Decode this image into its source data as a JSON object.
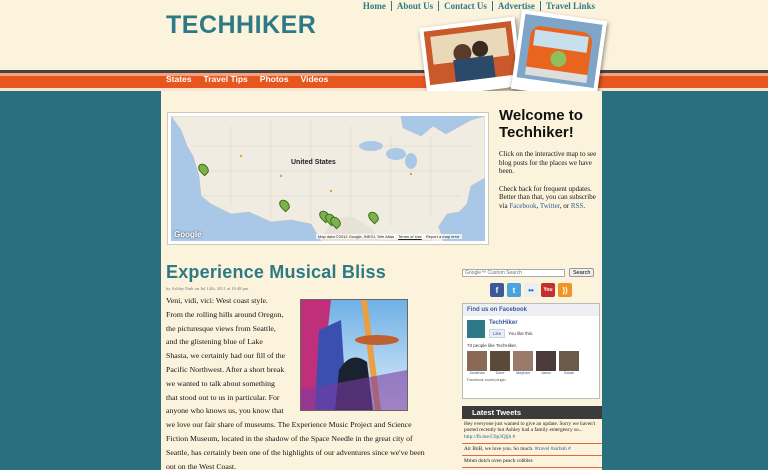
{
  "brand": {
    "logo": "TECHHIKER"
  },
  "top_nav": [
    "Home",
    "About Us",
    "Contact Us",
    "Advertise",
    "Travel Links"
  ],
  "main_nav": [
    "States",
    "Travel Tips",
    "Photos",
    "Videos"
  ],
  "map": {
    "country_label": "United States",
    "attribution": "Map data ©2012 Google, INEGI, Tele Atlas",
    "terms": "Terms of Use",
    "report": "Report a map error",
    "google": "Google",
    "marker_label": "7"
  },
  "welcome": {
    "title": "Welcome to Techhiker!",
    "para1": "Click on the interactive map to see blog posts for the places we have been.",
    "para2_prefix": "Check back for frequent updates. Better than that, you can subscribe via ",
    "link_facebook": "Facebook",
    "sep1": ", ",
    "link_twitter": "Twitter",
    "sep2": ", or ",
    "link_rss": "RSS",
    "suffix": "."
  },
  "post": {
    "title": "Experience Musical Bliss",
    "byline": "by Ashley Park on Jul 14th, 2011 at 10:48 pm",
    "lines_narrow": [
      "Veni, vidi, vici: West coast style.",
      "From the rolling hills around Oregon,",
      "the picturesque views from Seattle,",
      "and the glistening blue of Lake",
      "Shasta, we certainly had our fill of the",
      "Pacific Northwest. After a short break",
      "we wanted to talk about something",
      "that stood out to us in particular. For",
      "anyone who knows us, you know that"
    ],
    "lines_wide": [
      "we love our fair share of museums. The Experience Music Project and Science",
      "Fiction Museum, located in the shadow of the Space Needle in the great city of",
      "Seattle, has certainly been one of the highlights of our adventures since we've been",
      "out on the West Coast."
    ]
  },
  "search": {
    "placeholder": "Google™ Custom Search",
    "button": "Search"
  },
  "social_icons": [
    "facebook-icon",
    "twitter-icon",
    "flickr-icon",
    "youtube-icon",
    "rss-icon"
  ],
  "facebook_box": {
    "header": "Find us on Facebook",
    "page_name": "TechHiker",
    "like_button": "Like",
    "you_like": "You like this.",
    "count_text": "73 people like TechHiker.",
    "fans": [
      "Jonathan",
      "Dave",
      "Meghan",
      "Jason",
      "Sarah"
    ],
    "plugin": "Facebook social plugin"
  },
  "tweets": {
    "header": "Latest Tweets",
    "items": [
      {
        "text": "Hey everyone just wanted to give an update. Sorry we haven't posted recently but Ashley had a family emergency so... ",
        "link": "http://fb.me/C6p3Qljh #"
      },
      {
        "text": "Air BnB, we love you. So much. ",
        "link": "#travel #airbnb #"
      },
      {
        "text": "Mmm dutch oven peach cobbler.",
        "link": ""
      }
    ]
  },
  "colors": {
    "teal": "#2a6f7e",
    "orange": "#e8561f",
    "cream": "#fbf3dc",
    "title_teal": "#2d7a86"
  }
}
